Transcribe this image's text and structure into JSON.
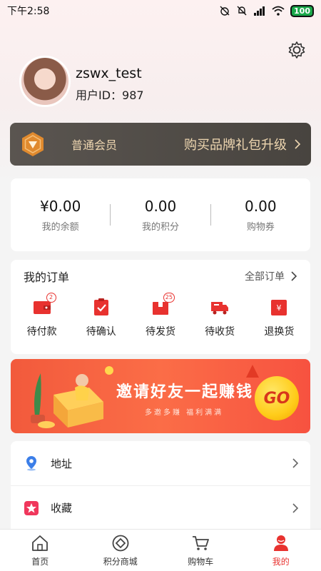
{
  "status_bar": {
    "time": "下午2:58",
    "battery": "100"
  },
  "profile": {
    "username": "zswx_test",
    "user_id": "用户ID：987"
  },
  "membership": {
    "level": "普通会员",
    "upgrade_label": "购买品牌礼包升级"
  },
  "wallet": [
    {
      "value": "¥0.00",
      "label": "我的余额"
    },
    {
      "value": "0.00",
      "label": "我的积分"
    },
    {
      "value": "0.00",
      "label": "购物券"
    }
  ],
  "orders": {
    "title": "我的订单",
    "all_label": "全部订单",
    "items": [
      {
        "label": "待付款",
        "icon": "wallet-icon",
        "badge": "2"
      },
      {
        "label": "待确认",
        "icon": "clipboard-check-icon",
        "badge": ""
      },
      {
        "label": "待发货",
        "icon": "package-icon",
        "badge": "25"
      },
      {
        "label": "待收货",
        "icon": "truck-icon",
        "badge": ""
      },
      {
        "label": "退换货",
        "icon": "refund-icon",
        "badge": ""
      }
    ]
  },
  "banner": {
    "title": "邀请好友一起赚钱",
    "subtitle": "多邀多赚  福利满满",
    "button": "GO"
  },
  "menu": [
    {
      "label": "地址",
      "icon": "location-pin-icon"
    },
    {
      "label": "收藏",
      "icon": "star-icon"
    }
  ],
  "tabs": [
    {
      "label": "首页",
      "icon": "home-icon"
    },
    {
      "label": "积分商城",
      "icon": "points-mall-icon"
    },
    {
      "label": "购物车",
      "icon": "cart-icon"
    },
    {
      "label": "我的",
      "icon": "profile-icon",
      "active": true
    }
  ],
  "colors": {
    "accent": "#e8322f",
    "member_bar": "#4f4a45",
    "member_text": "#eed6b0",
    "banner": "#f75a3f"
  }
}
